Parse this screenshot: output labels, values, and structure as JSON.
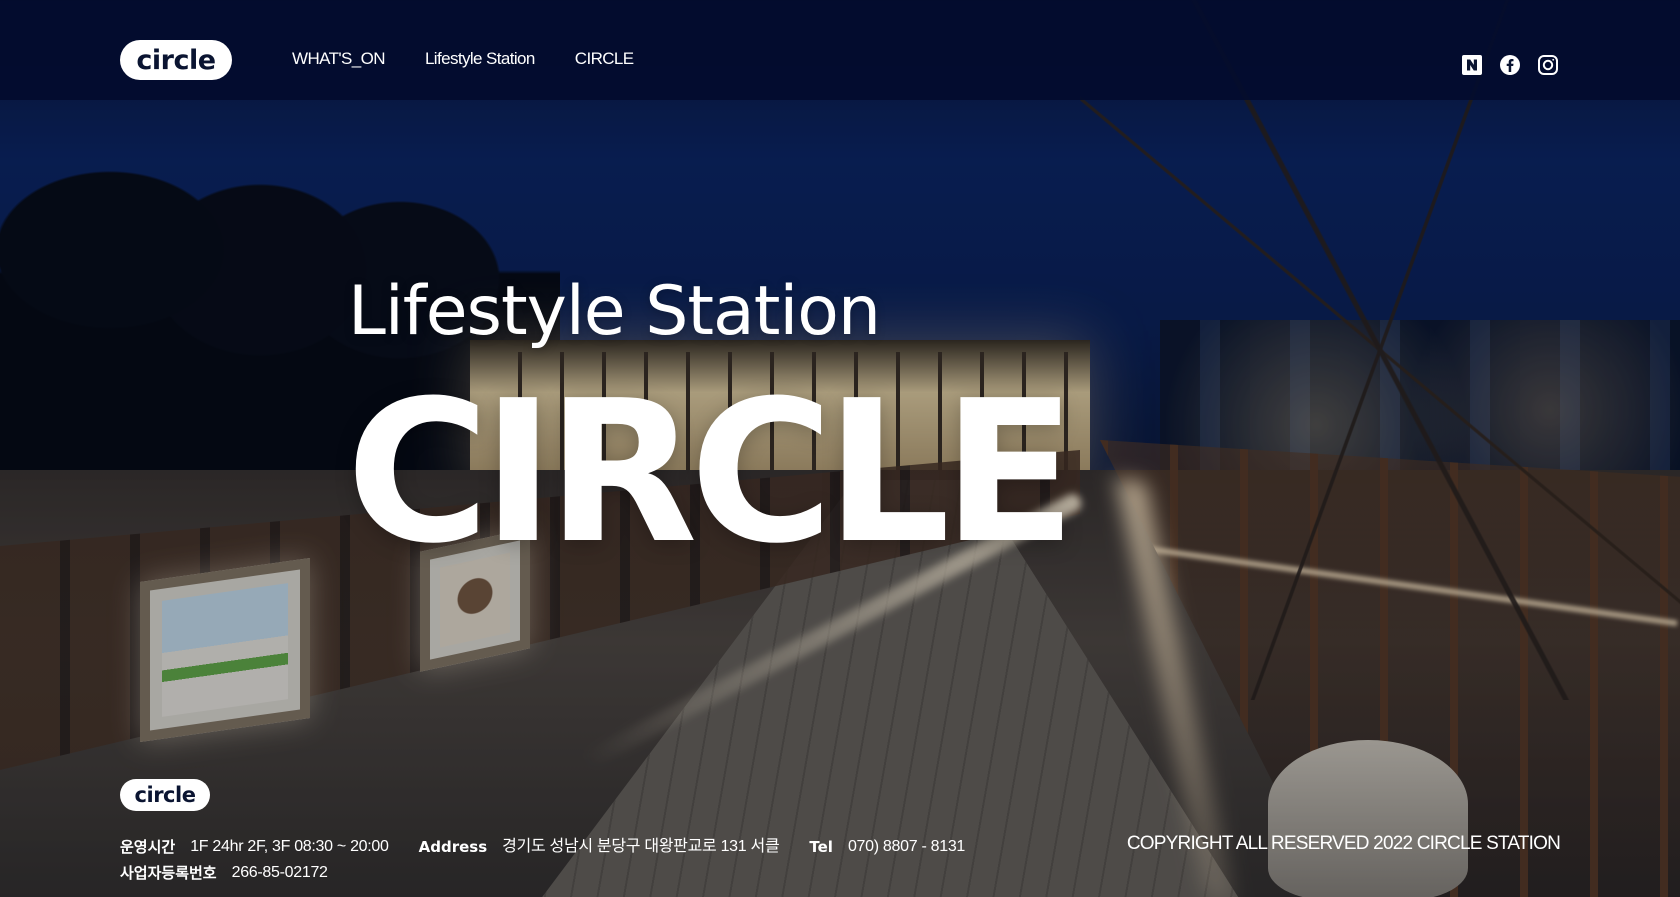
{
  "header": {
    "logo_text": "circle",
    "nav": [
      {
        "label": "WHAT'S_ON"
      },
      {
        "label": "Lifestyle Station"
      },
      {
        "label": "CIRCLE"
      }
    ],
    "social": [
      "naver-icon",
      "facebook-icon",
      "instagram-icon"
    ]
  },
  "hero": {
    "subtitle": "Lifestyle Station",
    "title": "CIRCLE"
  },
  "footer": {
    "logo_text": "circle",
    "hours_label": "운영시간",
    "hours_value": "1F 24hr 2F, 3F 08:30 ~ 20:00",
    "address_label": "Address",
    "address_value": "경기도 성남시 분당구 대왕판교로 131 서클",
    "tel_label": "Tel",
    "tel_value": "070) 8807 - 8131",
    "biz_label": "사업자등록번호",
    "biz_value": "266-85-02172",
    "copyright": "COPYRIGHT ALL RESERVED 2022 CIRCLE STATION"
  },
  "colors": {
    "header_bg": "#030c2e",
    "logo_text": "#0a1431",
    "text": "#ffffff"
  }
}
